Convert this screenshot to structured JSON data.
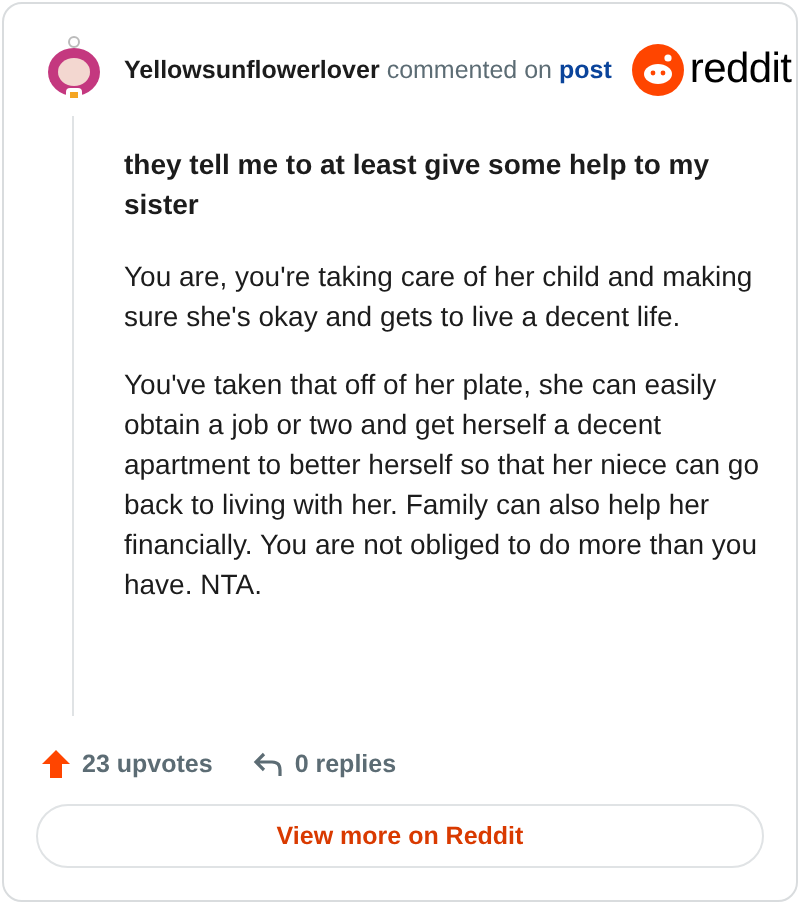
{
  "comment": {
    "author": "Yellowsunflowerlover",
    "action": "commented on",
    "target": "post",
    "brand": "reddit",
    "title": "they tell me to at least give some help to my sister",
    "paragraphs": [
      "You are, you're taking care of her child and making sure she's okay and gets to live a decent life.",
      "You've taken that off of her plate, she can easily obtain a job or two and get herself a decent apartment to better herself so that her niece can go back to living with her. Family can also help her financially. You are not obliged to do more than you have. NTA."
    ],
    "upvotes": "23 upvotes",
    "replies": "0 replies"
  },
  "button": "View more on Reddit"
}
